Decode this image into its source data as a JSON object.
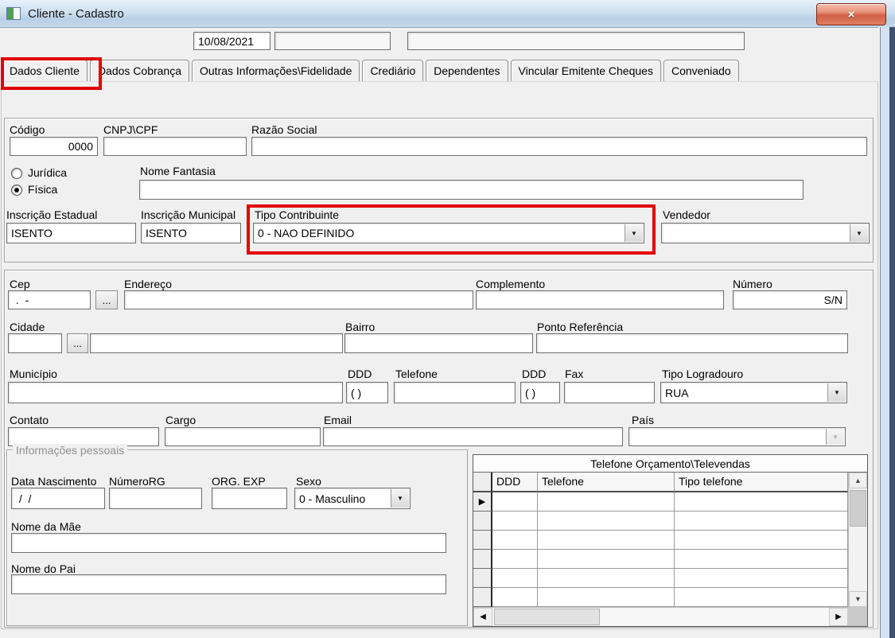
{
  "window": {
    "title": "Cliente - Cadastro"
  },
  "icons": {
    "close": "×",
    "dropdown": "▼",
    "scroll_up": "▲",
    "scroll_down": "▼",
    "scroll_left": "◀",
    "scroll_right": "▶",
    "record_marker": "▶"
  },
  "colors": {
    "highlight_red": "#e10000",
    "titlebar_blue": "#c6d8ea",
    "close_button_red": "#cf6045",
    "frame_navy": "#41506c",
    "client_gray": "#f0f0f0"
  },
  "topbar": {
    "date_value": "10/08/2021",
    "field2_value": "",
    "field3_value": ""
  },
  "tabs": {
    "items": [
      "Dados Cliente",
      "Dados Cobrança",
      "Outras Informações\\Fidelidade",
      "Crediário",
      "Dependentes",
      "Vincular Emitente Cheques",
      "Conveniado"
    ]
  },
  "main": {
    "codigo_label": "Código",
    "codigo_value": "0000",
    "cnpj_cpf_label": "CNPJ\\CPF",
    "cnpj_cpf_value": "",
    "razao_social_label": "Razão Social",
    "razao_social_value": "",
    "radio_juridica_label": "Jurídica",
    "radio_fisica_label": "Física",
    "nome_fantasia_label": "Nome Fantasia",
    "nome_fantasia_value": "",
    "inscricao_estadual_label": "Inscrição Estadual",
    "inscricao_estadual_value": "ISENTO",
    "inscricao_municipal_label": "Inscrição Municipal",
    "inscricao_municipal_value": "ISENTO",
    "tipo_contribuinte_label": "Tipo Contribuinte",
    "tipo_contribuinte_value": "0 - NAO DEFINIDO",
    "vendedor_label": "Vendedor",
    "vendedor_value": ""
  },
  "address": {
    "cep_label": "Cep",
    "cep_value": " .  -",
    "browse_label": "...",
    "endereco_label": "Endereço",
    "endereco_value": "",
    "complemento_label": "Complemento",
    "complemento_value": "",
    "numero_label": "Número",
    "numero_value": "S/N",
    "cidade_label": "Cidade",
    "cidade_code_value": "",
    "cidade_nome_value": "",
    "bairro_label": "Bairro",
    "bairro_value": "",
    "ponto_referencia_label": "Ponto Referência",
    "ponto_referencia_value": "",
    "municipio_label": "Município",
    "municipio_value": "",
    "ddd1_label": "DDD",
    "ddd1_value": "( )",
    "telefone_label": "Telefone",
    "telefone_value": "",
    "ddd2_label": "DDD",
    "ddd2_value": "( )",
    "fax_label": "Fax",
    "fax_value": "",
    "tipo_logradouro_label": "Tipo Logradouro",
    "tipo_logradouro_value": "RUA",
    "contato_label": "Contato",
    "contato_value": "",
    "cargo_label": "Cargo",
    "cargo_value": "",
    "email_label": "Email",
    "email_value": "",
    "pais_label": "País",
    "pais_value": ""
  },
  "personal": {
    "group_title": "Informações pessoais",
    "data_nascimento_label": "Data Nascimento",
    "data_nascimento_value": " /  /",
    "numero_rg_label": "NúmeroRG",
    "numero_rg_value": "",
    "org_exp_label": "ORG. EXP",
    "org_exp_value": "",
    "sexo_label": "Sexo",
    "sexo_value": "0 - Masculino",
    "nome_mae_label": "Nome da Mãe",
    "nome_mae_value": "",
    "nome_pai_label": "Nome do Pai",
    "nome_pai_value": ""
  },
  "phone_table": {
    "title": "Telefone Orçamento\\Televendas",
    "columns": [
      "DDD",
      "Telefone",
      "Tipo telefone"
    ],
    "row_count": 6
  }
}
